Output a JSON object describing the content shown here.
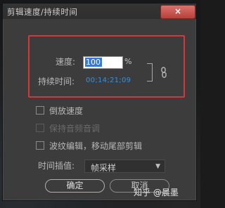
{
  "dialog": {
    "title": "剪辑速度/持续时间",
    "close_label": "×"
  },
  "speed": {
    "label": "速度:",
    "value": "100",
    "unit": "%"
  },
  "duration": {
    "label": "持续时间:",
    "value": "00;14;21;09"
  },
  "options": {
    "reverse_label": "倒放速度",
    "maintain_audio_label": "保持音频音调",
    "ripple_label": "波纹编辑，移动尾部剪辑"
  },
  "interpolation": {
    "label": "时间插值:",
    "selected": "帧采样"
  },
  "buttons": {
    "ok_label": "确定",
    "cancel_label": "取消"
  },
  "watermark": "知乎 @晨墨",
  "colors": {
    "highlight_box": "#d9363a",
    "duration_text": "#3d8fd8",
    "close_button": "#c4514a"
  }
}
